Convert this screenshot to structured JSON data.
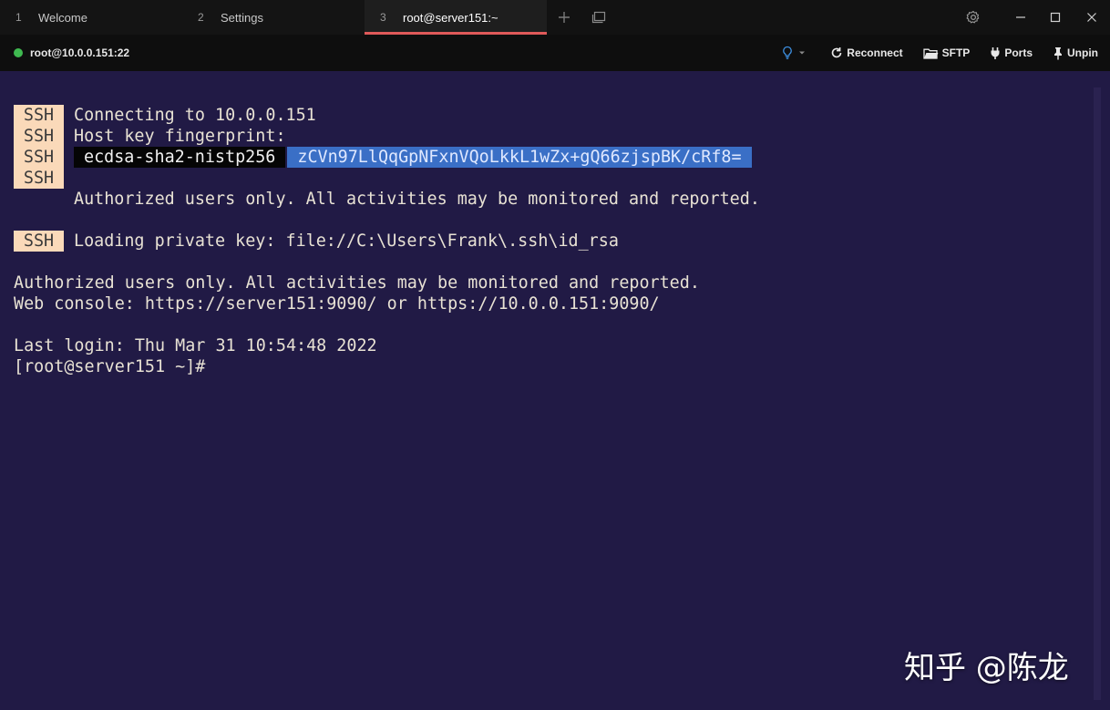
{
  "tabs": [
    {
      "number": "1",
      "label": "Welcome"
    },
    {
      "number": "2",
      "label": "Settings"
    },
    {
      "number": "3",
      "label": "root@server151:~"
    }
  ],
  "icons": {
    "new_tab": "plus-icon",
    "tab_overview": "layers-icon",
    "settings": "gear-icon",
    "minimize": "minimize-icon",
    "maximize": "maximize-icon",
    "close": "close-icon",
    "status": "green-dot",
    "hint": "lightbulb-icon",
    "reconnect": "refresh-icon",
    "sftp": "folder-icon",
    "ports": "plug-icon",
    "unpin": "pin-icon"
  },
  "header": {
    "connection": "root@10.0.0.151:22",
    "reconnect": "Reconnect",
    "sftp": "SFTP",
    "ports": "Ports",
    "unpin": "Unpin"
  },
  "colors": {
    "terminal_bg": "#211a45",
    "ssh_badge_bg": "#fad9b9",
    "accent_tab": "#e05a5a",
    "status_online": "#3fb950",
    "selection": "#3a6fc6"
  },
  "terminal": {
    "ssh_label": "SSH",
    "connecting": "Connecting to 10.0.0.151",
    "host_key": "Host key fingerprint:",
    "key_type": "ecdsa-sha2-nistp256",
    "key_hash": "zCVn97LlQqGpNFxnVQoLkkL1wZx+gQ66zjspBK/cRf8=",
    "banner1": "Authorized users only. All activities may be monitored and reported.",
    "loading_key": "Loading private key: file://C:\\Users\\Frank\\.ssh\\id_rsa",
    "banner2": "Authorized users only. All activities may be monitored and reported.",
    "web_console": "Web console: https://server151:9090/ or https://10.0.0.151:9090/",
    "last_login": "Last login: Thu Mar 31 10:54:48 2022",
    "prompt": "[root@server151 ~]#"
  },
  "watermark": "知乎 @陈龙"
}
